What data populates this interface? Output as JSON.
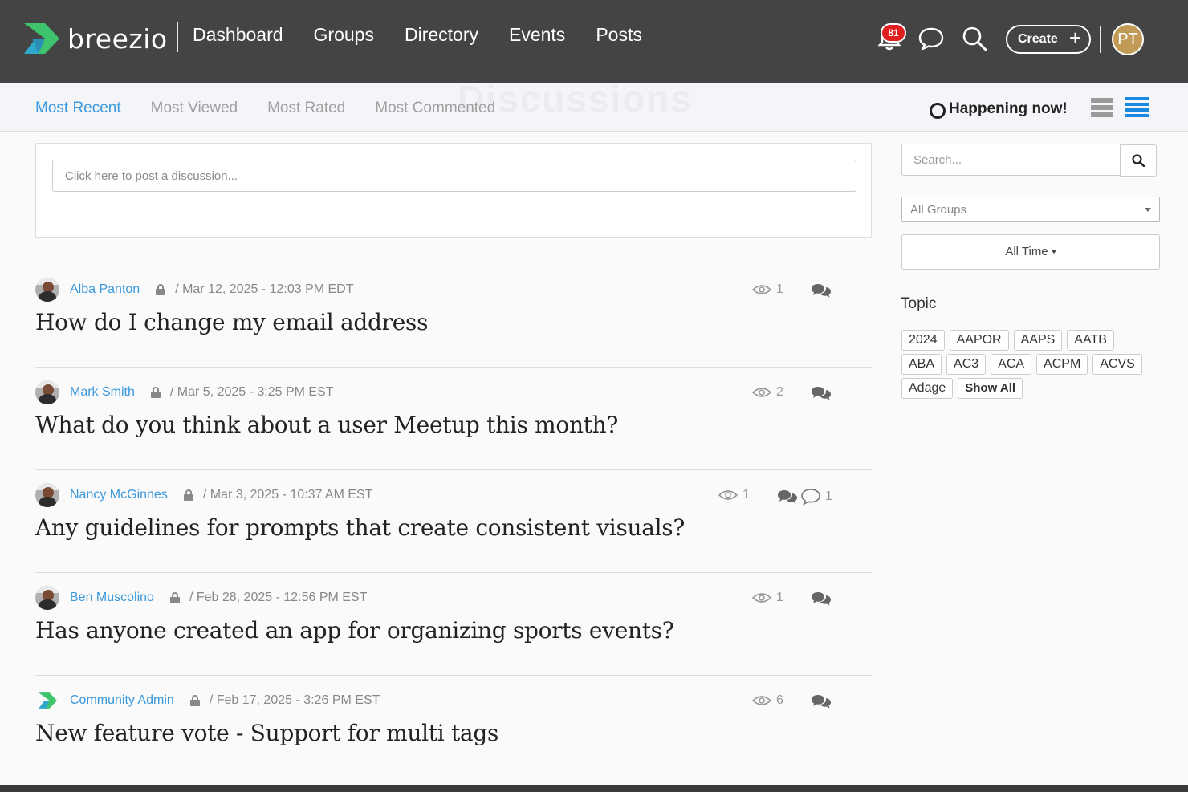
{
  "app": {
    "brand": "breezio",
    "colors": {
      "topbar": "#444444",
      "accent": "#3b98dc",
      "badge": "#e02020",
      "avatar": "#c19a56"
    }
  },
  "nav": {
    "items": [
      "Dashboard",
      "Groups",
      "Directory",
      "Events",
      "Posts"
    ]
  },
  "topbar": {
    "notification_count": "81",
    "create_label": "Create",
    "user_initials": "PT",
    "icons": [
      "bell-icon",
      "chat-bubble-icon",
      "search-icon",
      "plus-icon"
    ]
  },
  "page": {
    "ghost_title": "Discussions"
  },
  "filters": {
    "tabs": [
      {
        "label": "Most Recent",
        "active": true
      },
      {
        "label": "Most Viewed",
        "active": false
      },
      {
        "label": "Most Rated",
        "active": false
      },
      {
        "label": "Most Commented",
        "active": false
      }
    ],
    "happening_now": "Happening now!",
    "view_modes": [
      "list-view-icon",
      "compact-view-icon"
    ]
  },
  "composer": {
    "placeholder": "Click here to post a discussion..."
  },
  "discussions": [
    {
      "author": "Alba Panton",
      "date": "/ Mar 12, 2025 - 12:03 PM EDT",
      "title": "How do I change my email address",
      "views": "1",
      "comments": ""
    },
    {
      "author": "Mark Smith",
      "date": "/ Mar 5, 2025 - 3:25 PM EST",
      "title": "What do you think about a user Meetup this month?",
      "views": "2",
      "comments": ""
    },
    {
      "author": "Nancy McGinnes",
      "date": "/ Mar 3, 2025 - 10:37 AM EST",
      "title": "Any guidelines for prompts that create consistent visuals?",
      "views": "1",
      "comments": "1"
    },
    {
      "author": "Ben Muscolino",
      "date": "/ Feb 28, 2025 - 12:56 PM EST",
      "title": "Has anyone created an app for organizing sports events?",
      "views": "1",
      "comments": ""
    },
    {
      "author": "Community Admin",
      "date": "/ Feb 17, 2025 - 3:26 PM EST",
      "title": "New feature vote - Support for multi tags",
      "views": "6",
      "comments": ""
    }
  ],
  "sidebar": {
    "search_placeholder": "Search...",
    "groups_select": "All Groups",
    "time_select": "All Time",
    "topic_label": "Topic",
    "tags": [
      "2024",
      "AAPOR",
      "AAPS",
      "AATB",
      "ABA",
      "AC3",
      "ACA",
      "ACPM",
      "ACVS",
      "Adage"
    ],
    "show_all": "Show All"
  }
}
